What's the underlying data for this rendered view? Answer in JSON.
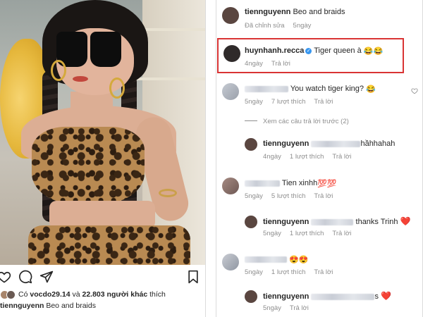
{
  "left_post": {
    "likes_prefix": "Có",
    "liker": "vocdo29.14",
    "likes_middle": "và",
    "others_count": "22.803 người khác",
    "likes_suffix": "thích",
    "caption_user": "tiennguyenn",
    "caption_text": "Beo and braids"
  },
  "comments": {
    "caption": {
      "user": "tiennguyenn",
      "text": "Beo and braids",
      "meta_edited": "Đã chỉnh sửa",
      "meta_time": "5ngày"
    },
    "c1": {
      "user": "huynhanh.recca",
      "text": "Tiger queen à",
      "emoji": "😂😂",
      "time": "4ngày",
      "reply": "Trả lời"
    },
    "c2": {
      "text": "You watch tiger king?",
      "emoji": "😂",
      "time": "5ngày",
      "likes": "7 lượt thích",
      "reply": "Trả lời"
    },
    "view_replies": "Xem các câu trả lời trước (2)",
    "c3": {
      "user": "tiennguyenn",
      "text": "hầhhahah",
      "time": "4ngày",
      "likes": "1 lượt thích",
      "reply": "Trả lời"
    },
    "c4": {
      "text": "Tien xinhh",
      "emoji": "💯💯",
      "time": "5ngày",
      "likes": "5 lượt thích",
      "reply": "Trả lời"
    },
    "c5": {
      "user": "tiennguyenn",
      "text": "thanks Trinh",
      "emoji": "❤️",
      "time": "5ngày",
      "likes": "1 lượt thích",
      "reply": "Trả lời"
    },
    "c6": {
      "emoji": "😍😍",
      "time": "5ngày",
      "likes": "1 lượt thích",
      "reply": "Trả lời"
    },
    "c7": {
      "user": "tiennguyenn",
      "emoji": "❤️",
      "suffix": "s",
      "time": "5ngày",
      "reply": "Trả lời"
    }
  },
  "colors": {
    "highlight_border": "#d93434",
    "verified": "#3897f0",
    "heart": "#ed4956"
  }
}
